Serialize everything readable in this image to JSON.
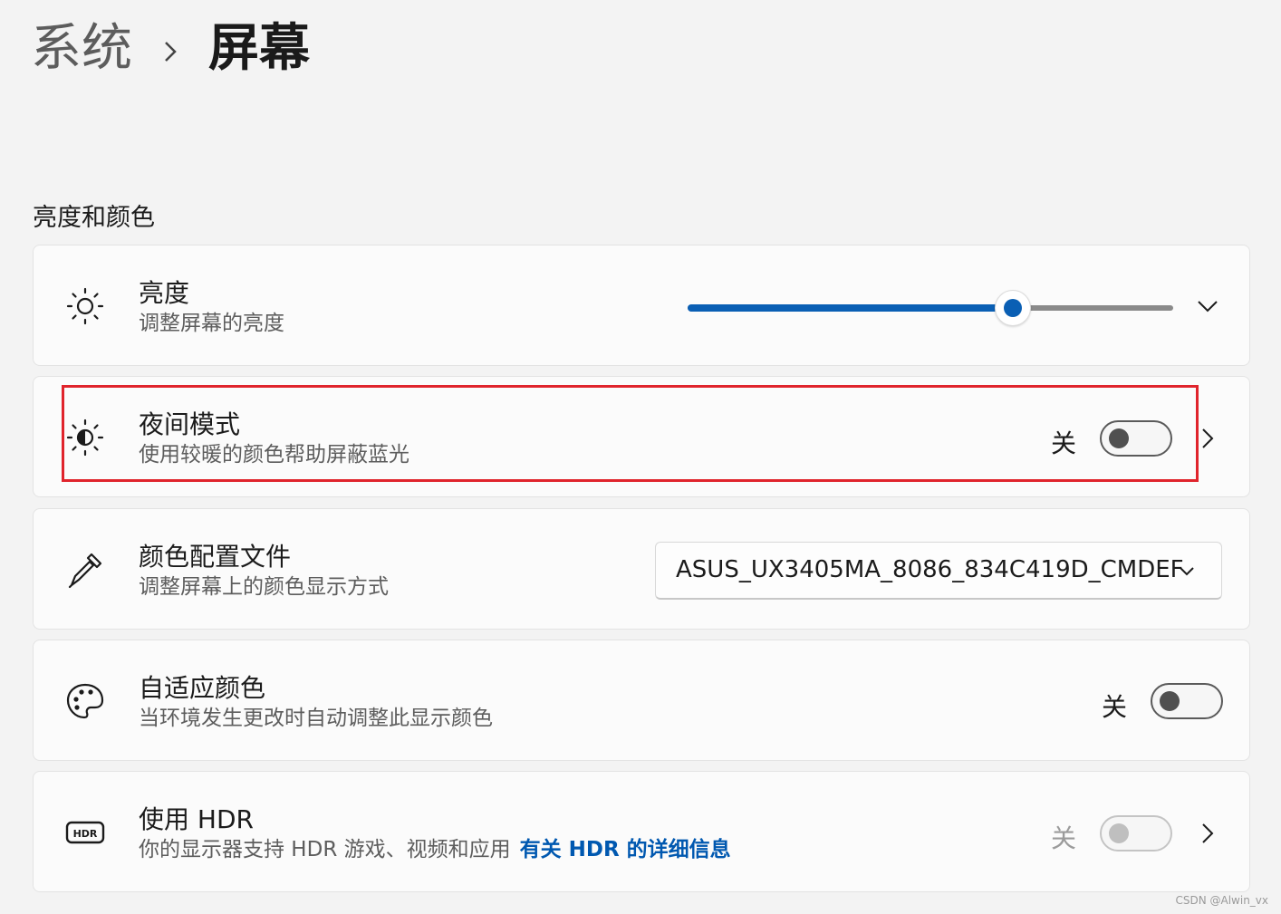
{
  "breadcrumb": {
    "parent": "系统",
    "separator_icon": "chevron-right-icon",
    "current": "屏幕"
  },
  "section": {
    "title": "亮度和颜色"
  },
  "settings": {
    "brightness": {
      "icon": "sun-icon",
      "title": "亮度",
      "description": "调整屏幕的亮度",
      "slider_value_percent": 67,
      "expand_icon": "chevron-down-icon"
    },
    "night_light": {
      "icon": "night-light-icon",
      "title": "夜间模式",
      "description": "使用较暖的颜色帮助屏蔽蓝光",
      "state_label": "关",
      "toggle_on": false,
      "nav_icon": "chevron-right-icon"
    },
    "color_profile": {
      "icon": "eyedropper-icon",
      "title": "颜色配置文件",
      "description": "调整屏幕上的颜色显示方式",
      "selected_value": "ASUS_UX3405MA_8086_834C419D_CMDEF"
    },
    "adaptive_color": {
      "icon": "palette-icon",
      "title": "自适应颜色",
      "description": "当环境发生更改时自动调整此显示颜色",
      "state_label": "关",
      "toggle_on": false
    },
    "hdr": {
      "icon": "hdr-icon",
      "title": "使用 HDR",
      "description": "你的显示器支持 HDR 游戏、视频和应用",
      "link": "有关 HDR 的详细信息",
      "state_label": "关",
      "toggle_on": false,
      "disabled": true,
      "nav_icon": "chevron-right-icon"
    }
  },
  "colors": {
    "accent": "#0a5fb4",
    "highlight": "#e0242c",
    "link": "#0058b0"
  },
  "watermark": "CSDN @Alwin_vx"
}
